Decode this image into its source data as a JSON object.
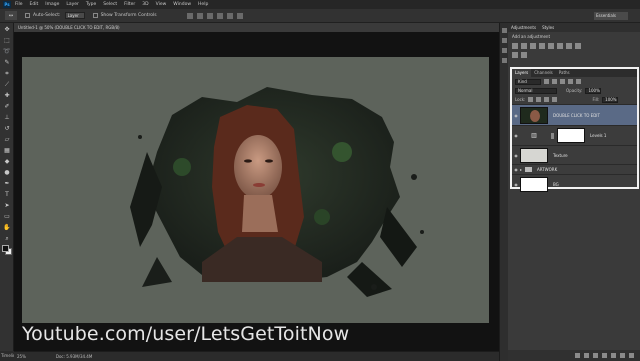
{
  "menu": {
    "logo": "Ps",
    "items": [
      "File",
      "Edit",
      "Image",
      "Layer",
      "Type",
      "Select",
      "Filter",
      "3D",
      "View",
      "Window",
      "Help"
    ]
  },
  "options": {
    "tool_icon": "↔",
    "auto_select_label": "Auto-Select:",
    "auto_select_value": "Layer",
    "transform_label": "Show Transform Controls",
    "workspace": "Essentials"
  },
  "document": {
    "tab_title": "Untitled-1 @ 50% (DOUBLE CLICK TO EDIT, RGB/8)"
  },
  "watermark": "Youtube.com/user/LetsGetToitNow",
  "status": {
    "zoom": "25%",
    "doc_size": "Doc: 5.93M/34.4M"
  },
  "bottom_tab": "Timeline",
  "adjustments": {
    "tabs": [
      "Adjustments",
      "Styles"
    ],
    "title": "Add an adjustment"
  },
  "layers_panel": {
    "tabs": [
      "Layers",
      "Channels",
      "Paths"
    ],
    "filter": "Kind",
    "blend_mode": "Normal",
    "opacity_label": "Opacity:",
    "opacity_value": "100%",
    "lock_label": "Lock:",
    "fill_label": "Fill:",
    "fill_value": "100%",
    "layers": [
      {
        "name": "DOUBLE CLICK TO EDIT",
        "selected": true
      },
      {
        "name": "Levels 1",
        "selected": false
      },
      {
        "name": "Texture",
        "selected": false
      },
      {
        "name": "ARTWORK",
        "selected": false
      },
      {
        "name": "BG",
        "selected": false
      }
    ]
  },
  "colors": {
    "canvas": "#5d635b",
    "selection": "#5a6a86",
    "panel_highlight": "#f2f2f2"
  }
}
